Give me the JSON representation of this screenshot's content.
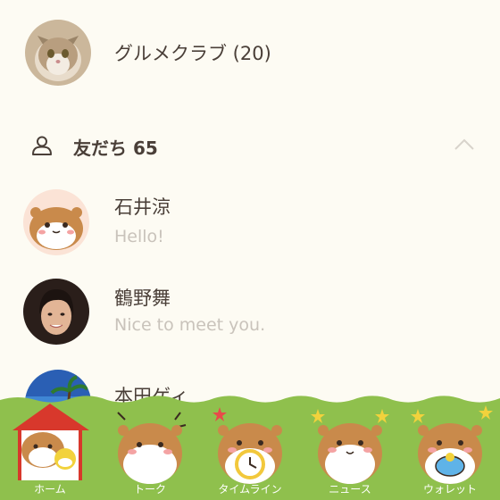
{
  "group": {
    "name": "グルメクラブ (20)"
  },
  "friends_section": {
    "label": "友だち 65"
  },
  "friends": [
    {
      "name": "石井涼",
      "status": "Hello!"
    },
    {
      "name": "鶴野舞",
      "status": "Nice to meet you."
    },
    {
      "name": "本田ゲィ"
    }
  ],
  "tabs": [
    {
      "label": "ホーム",
      "icon": "hamster-house-icon"
    },
    {
      "label": "トーク",
      "icon": "hamster-talk-icon"
    },
    {
      "label": "タイムライン",
      "icon": "hamster-clock-icon"
    },
    {
      "label": "ニュース",
      "icon": "hamster-news-icon"
    },
    {
      "label": "ウォレット",
      "icon": "hamster-wallet-icon"
    }
  ],
  "colors": {
    "background": "#fdfbf3",
    "grass": "#8fc04d",
    "text_primary": "#4a3f38",
    "text_secondary": "#c9c3bb"
  }
}
